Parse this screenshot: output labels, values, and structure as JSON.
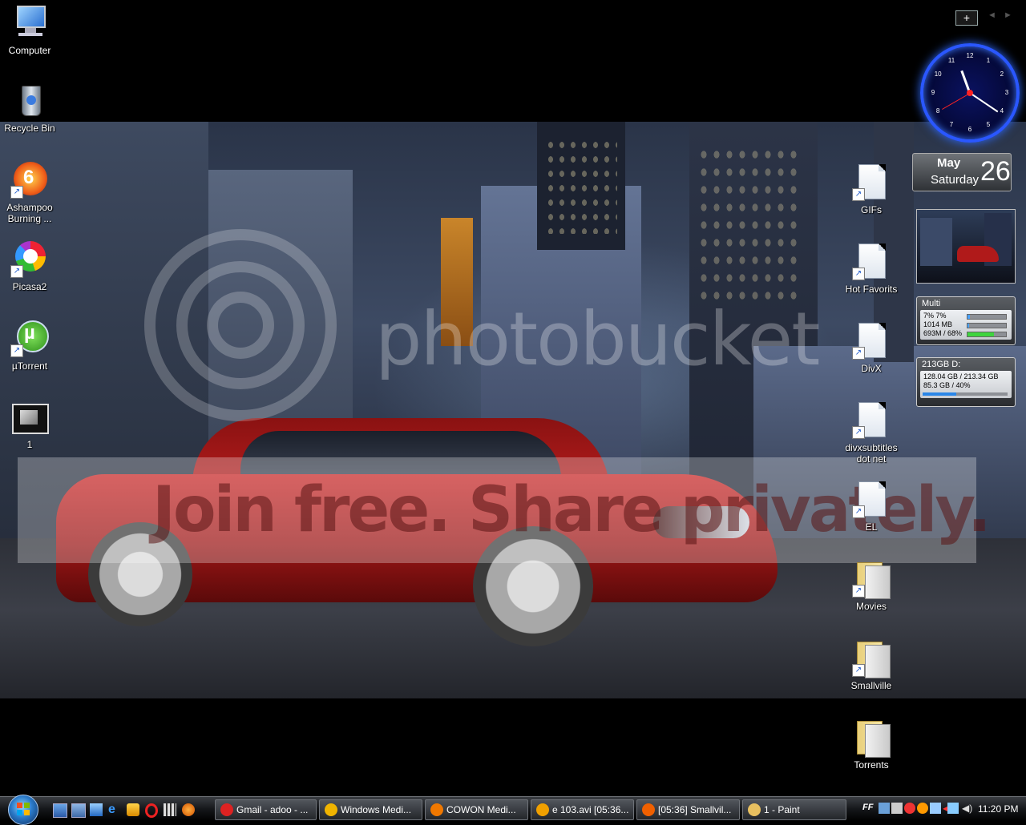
{
  "watermark": {
    "brand": "photobucket",
    "tagline": "Join free. Share privately."
  },
  "desktop_left": [
    {
      "label": "Computer",
      "icon": "computer-icon"
    },
    {
      "label": "Recycle Bin",
      "icon": "recycle-bin-icon"
    },
    {
      "label": "Ashampoo Burning ...",
      "icon": "ashampoo-icon",
      "badge": "6"
    },
    {
      "label": "Picasa2",
      "icon": "picasa-icon"
    },
    {
      "label": "µTorrent",
      "icon": "utorrent-icon",
      "glyph": "µ"
    },
    {
      "label": "1",
      "icon": "image-thumbnail-icon"
    }
  ],
  "desktop_right": [
    {
      "label": "GIFs",
      "icon": "document-icon"
    },
    {
      "label": "Hot Favorits",
      "icon": "document-icon"
    },
    {
      "label": "DivX",
      "icon": "document-icon"
    },
    {
      "label": "divxsubtitles dot net",
      "icon": "document-icon"
    },
    {
      "label": "EL",
      "icon": "document-icon"
    },
    {
      "label": "Movies",
      "icon": "folder-icon"
    },
    {
      "label": "Smallville",
      "icon": "folder-icon"
    },
    {
      "label": "Torrents",
      "icon": "folder-icon"
    }
  ],
  "sidebar": {
    "add_label": "+",
    "clock_numbers": [
      "12",
      "1",
      "2",
      "3",
      "4",
      "5",
      "6",
      "7",
      "8",
      "9",
      "10",
      "11"
    ],
    "clock": {
      "hour": 11,
      "minute": 20,
      "second": 40
    },
    "calendar": {
      "month": "May",
      "weekday": "Saturday",
      "date": "26"
    },
    "multi": {
      "title": "Multi",
      "rows": [
        {
          "text": "7%   7%",
          "fill": 0.07,
          "color": "#4aa3ff"
        },
        {
          "text": "1014 MB",
          "fill": 0.05,
          "color": "#4aa3ff"
        },
        {
          "text": "693M / 68%",
          "fill": 0.68,
          "color": "#3fd43f"
        }
      ]
    },
    "drive": {
      "title": "213GB D:",
      "rows": [
        {
          "text": "128.04 GB / 213.34 GB"
        },
        {
          "text": "85.3 GB / 40%"
        }
      ],
      "fill": 0.4
    }
  },
  "taskbar": {
    "tasks": [
      {
        "label": "Gmail - adoo - ...",
        "icon": "opera-icon",
        "color": "#d22"
      },
      {
        "label": "Windows Medi...",
        "icon": "media-player-icon",
        "color": "#f0b400"
      },
      {
        "label": "COWON Medi...",
        "icon": "cowon-icon",
        "color": "#f07800"
      },
      {
        "label": "e 103.avi [05:36...",
        "icon": "player-icon",
        "color": "#f0a000"
      },
      {
        "label": "[05:36] Smallvil...",
        "icon": "player-icon",
        "color": "#f06000"
      },
      {
        "label": "1 - Paint",
        "icon": "paint-icon",
        "color": "#e8c060"
      }
    ],
    "tray_time": "11:20 PM",
    "tray_ff": "FF"
  }
}
